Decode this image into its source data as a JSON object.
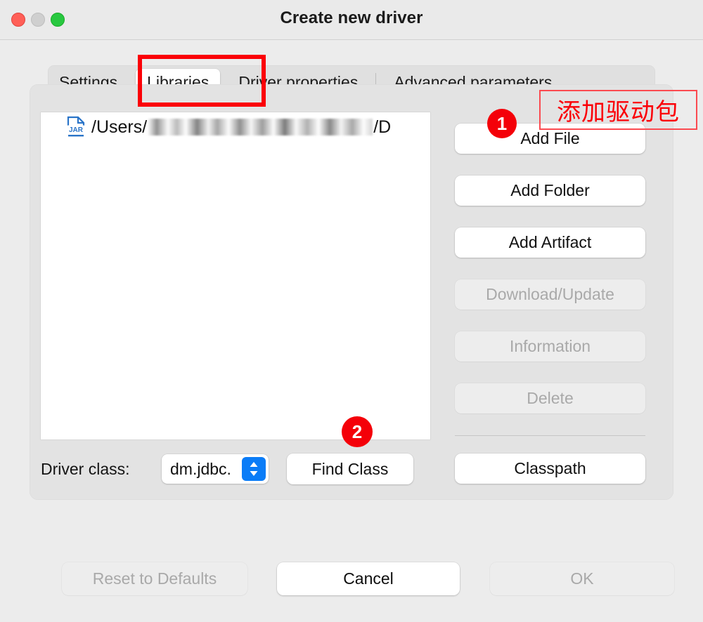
{
  "window": {
    "title": "Create new driver",
    "traffic_lights": [
      "close-red",
      "minimize-gray",
      "zoom-green"
    ]
  },
  "tabs": [
    {
      "label": "Settings",
      "selected": false
    },
    {
      "label": "Libraries",
      "selected": true
    },
    {
      "label": "Driver properties",
      "selected": false
    },
    {
      "label": "Advanced parameters",
      "selected": false
    }
  ],
  "libraries": {
    "list": [
      {
        "icon": "jar-file-icon",
        "path_prefix": "/Users/",
        "path_redacted": true,
        "path_suffix": "/D"
      }
    ]
  },
  "driver_class": {
    "label": "Driver class:",
    "value": "dm.jdbc.",
    "find_button": "Find Class",
    "stepper_icon": "chevron-up-down-icon",
    "stepper_color": "#0a7cf7"
  },
  "side_buttons": [
    {
      "label": "Add File",
      "enabled": true
    },
    {
      "label": "Add Folder",
      "enabled": true
    },
    {
      "label": "Add Artifact",
      "enabled": true
    },
    {
      "label": "Download/Update",
      "enabled": false
    },
    {
      "label": "Information",
      "enabled": false
    },
    {
      "label": "Delete",
      "enabled": false
    },
    {
      "label": "Classpath",
      "enabled": true
    }
  ],
  "bottom_buttons": {
    "reset": {
      "label": "Reset to Defaults",
      "enabled": false
    },
    "cancel": {
      "label": "Cancel",
      "enabled": true
    },
    "ok": {
      "label": "OK",
      "enabled": false
    }
  },
  "annotations": {
    "accent_color": "#fb0007",
    "tab_highlight": "Libraries",
    "note_text": "添加驱动包",
    "badges": [
      {
        "number": "1",
        "target": "Add File"
      },
      {
        "number": "2",
        "target": "Find Class"
      }
    ]
  }
}
